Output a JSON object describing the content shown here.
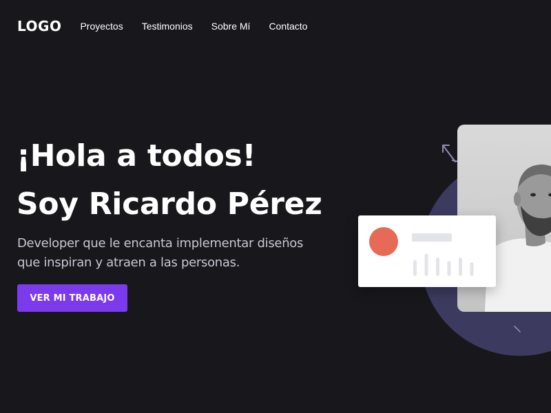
{
  "nav": {
    "logo": "LOGO",
    "links": [
      "Proyectos",
      "Testimonios",
      "Sobre Mí",
      "Contacto"
    ]
  },
  "hero": {
    "greeting": "¡Hola a todos!",
    "intro": "Soy Ricardo Pérez",
    "subtitle": "Developer que le encanta implementar diseños que inspiran y atraen a las personas.",
    "cta_label": "VER MI TRABAJO"
  },
  "colors": {
    "background": "#18171c",
    "accent": "#7c3aed",
    "circle": "#3c3a5f",
    "card_dot": "#e66a55"
  },
  "illustration": {
    "photo": "portrait-photo",
    "card_bar_levels": [
      0.65,
      0.9,
      0.75,
      0.6,
      0.75,
      0.55
    ]
  }
}
